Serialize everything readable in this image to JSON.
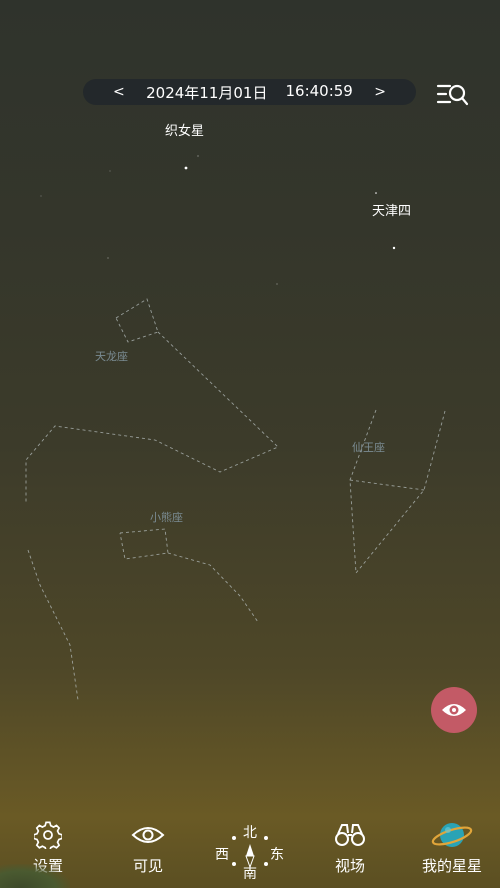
{
  "time_bar": {
    "prev": "<",
    "date": "2024年11月01日",
    "time": "16:40:59",
    "next": ">"
  },
  "stars": {
    "vega": "织女星",
    "deneb": "天津四"
  },
  "constellations": {
    "draco": "天龙座",
    "ursa_minor": "小熊座",
    "cepheus": "仙王座"
  },
  "compass": {
    "north": "北",
    "south": "南",
    "west": "西",
    "east": "东"
  },
  "bottom_nav": {
    "settings": "设置",
    "visible": "可见",
    "field_of_view": "视场",
    "my_stars": "我的星星"
  },
  "colors": {
    "fab": "#c35a66",
    "constellation_line": "#b8c0c0",
    "time_bar_bg": "#23282b"
  }
}
